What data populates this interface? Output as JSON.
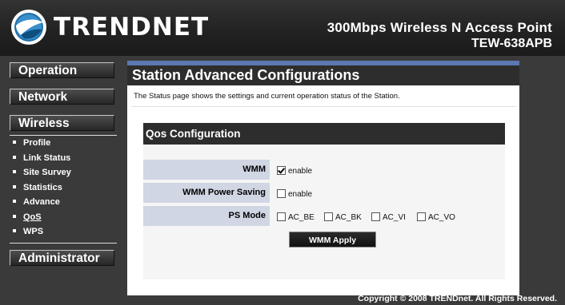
{
  "brand": {
    "name": "TRENDNET",
    "product_title": "300Mbps Wireless N Access Point",
    "model": "TEW-638APB"
  },
  "sidebar": {
    "main_items": [
      {
        "label": "Operation"
      },
      {
        "label": "Network"
      },
      {
        "label": "Wireless"
      },
      {
        "label": "Administrator"
      }
    ],
    "wireless_submenu": [
      {
        "label": "Profile"
      },
      {
        "label": "Link Status"
      },
      {
        "label": "Site Survey"
      },
      {
        "label": "Statistics"
      },
      {
        "label": "Advance"
      },
      {
        "label": "QoS",
        "current": true
      },
      {
        "label": "WPS"
      }
    ]
  },
  "main": {
    "title": "Station Advanced Configurations",
    "intro": "The Status page shows the settings and current operation status of the Station."
  },
  "qos": {
    "heading": "Qos Configuration",
    "wmm": {
      "label": "WMM",
      "option": "enable",
      "checked": true
    },
    "wmm_power_saving": {
      "label": "WMM Power Saving",
      "option": "enable",
      "checked": false
    },
    "ps_mode": {
      "label": "PS Mode",
      "options": [
        {
          "label": "AC_BE",
          "checked": false
        },
        {
          "label": "AC_BK",
          "checked": false
        },
        {
          "label": "AC_VI",
          "checked": false
        },
        {
          "label": "AC_VO",
          "checked": false
        }
      ]
    },
    "apply_label": "WMM Apply"
  },
  "footer": {
    "copyright": "Copyright © 2008 TRENDnet. All Rights Reserved."
  }
}
